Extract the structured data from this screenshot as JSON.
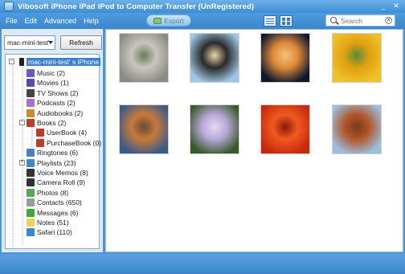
{
  "window": {
    "title": "Vibosoft iPhone iPad iPod to Computer Transfer (UnRegistered)"
  },
  "menu": [
    "File",
    "Edit",
    "Advanced",
    "Help"
  ],
  "toolbar": {
    "export_label": "Export",
    "search_placeholder": "Search"
  },
  "left_panel": {
    "device_select_value": "mac-mini-test'",
    "refresh_label": "Refresh"
  },
  "tree": {
    "device": "mac-mini-test' s iPhone",
    "items": [
      {
        "label": "Music (2)",
        "icon": "music-icon",
        "color": "#6a58c4"
      },
      {
        "label": "Movies (1)",
        "icon": "movies-icon",
        "color": "#5a4ab0"
      },
      {
        "label": "TV Shows (2)",
        "icon": "tv-icon",
        "color": "#444444"
      },
      {
        "label": "Podcasts (2)",
        "icon": "podcast-icon",
        "color": "#b06cc8"
      },
      {
        "label": "Audiobooks (2)",
        "icon": "audiobook-icon",
        "color": "#d08a2a"
      },
      {
        "label": "Books (2)",
        "icon": "books-icon",
        "color": "#c0392b"
      },
      {
        "label": "UserBook (4)",
        "icon": "book-icon",
        "color": "#c0392b"
      },
      {
        "label": "PurchaseBook (0)",
        "icon": "book-icon",
        "color": "#c0392b"
      },
      {
        "label": "Ringtones (6)",
        "icon": "ringtone-icon",
        "color": "#4a7fc0"
      },
      {
        "label": "Playlists (23)",
        "icon": "playlist-icon",
        "color": "#3f86c9"
      },
      {
        "label": "Voice Memos (8)",
        "icon": "voice-memo-icon",
        "color": "#333333"
      },
      {
        "label": "Camera Roll (9)",
        "icon": "camera-icon",
        "color": "#333333"
      },
      {
        "label": "Photos (8)",
        "icon": "photos-icon",
        "color": "#5aa65a"
      },
      {
        "label": "Contacts (650)",
        "icon": "contacts-icon",
        "color": "#9a9a9a"
      },
      {
        "label": "Messages (6)",
        "icon": "messages-icon",
        "color": "#3aa83a"
      },
      {
        "label": "Notes (51)",
        "icon": "notes-icon",
        "color": "#e8d25a"
      },
      {
        "label": "Safari (110)",
        "icon": "safari-icon",
        "color": "#3a86d0"
      }
    ]
  },
  "photos": [
    {
      "name": "koala",
      "colors": [
        "#8a8a86",
        "#c9c6bf",
        "#6b7a55"
      ]
    },
    {
      "name": "penguins",
      "colors": [
        "#9ec7e6",
        "#2a2a2a",
        "#e8d6a8"
      ]
    },
    {
      "name": "jellyfish",
      "colors": [
        "#0e1730",
        "#e08a3a",
        "#f4c27a"
      ]
    },
    {
      "name": "tulips",
      "colors": [
        "#f0c22a",
        "#e0a010",
        "#5a8a3a"
      ]
    },
    {
      "name": "lighthouse",
      "colors": [
        "#3a5a8a",
        "#c87a3a",
        "#6a4a3a"
      ]
    },
    {
      "name": "hydrangeas",
      "colors": [
        "#3a5a2a",
        "#b7a8d8",
        "#e4d8ee"
      ]
    },
    {
      "name": "chrysanthemum",
      "colors": [
        "#c8280e",
        "#f05a1e",
        "#8a1a08"
      ]
    },
    {
      "name": "desert",
      "colors": [
        "#9ac0e0",
        "#b2562a",
        "#7a3a1a"
      ]
    }
  ]
}
